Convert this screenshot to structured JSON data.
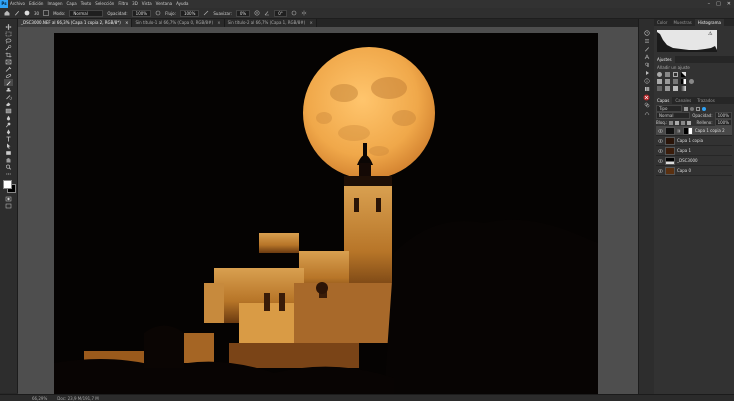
{
  "menubar": {
    "logo": "Ps",
    "items": [
      "Archivo",
      "Edición",
      "Imagen",
      "Capa",
      "Texto",
      "Selección",
      "Filtro",
      "3D",
      "Vista",
      "Ventana",
      "Ayuda"
    ]
  },
  "window_controls": {
    "minimize": "–",
    "maximize": "□",
    "close": "✕"
  },
  "options": {
    "brush_size": "30",
    "mode_label": "Modo:",
    "mode_value": "Normal",
    "opacity_label": "Opacidad:",
    "opacity_value": "100%",
    "flow_label": "Flujo:",
    "flow_value": "100%",
    "smoothing_label": "Suavizar:",
    "smoothing_value": "0%",
    "angle_value": "0°"
  },
  "doc_tabs": [
    {
      "label": "_DSC3000.NEF al 66,3% (Capa 1 copia 2, RGB/8*)",
      "close": "×"
    },
    {
      "label": "Sin título-1 al 66,7% (Capa 0, RGB/8#)",
      "close": "×"
    },
    {
      "label": "Sin título-2 al 66,7% (Capa 1, RGB/8#)",
      "close": "×"
    }
  ],
  "status": {
    "zoom": "66,29%",
    "doc": "Doc: 23,9 M/191,7 M"
  },
  "panels": {
    "top_tabs": [
      "Color",
      "Muestras",
      "Histograma"
    ],
    "adjust_tabs": [
      "Ajustes"
    ],
    "adjust_hint": "Añadir un ajuste",
    "layers_tabs": [
      "Capas",
      "Canales",
      "Trazados"
    ],
    "filter_label": "Tipo",
    "blend_mode": "Normal",
    "opacity_label": "Opacidad:",
    "opacity_value": "100%",
    "lock_label": "Bloq.:",
    "fill_label": "Relleno:",
    "fill_value": "100%",
    "layers": [
      {
        "name": "Capa 1 copia 2",
        "selected": true,
        "mask": true
      },
      {
        "name": "Capa 1 copia",
        "selected": false,
        "mask": false
      },
      {
        "name": "Capa 1",
        "selected": false,
        "mask": false
      },
      {
        "name": "_DSC3000",
        "selected": false,
        "mask": false
      },
      {
        "name": "Capa 0",
        "selected": false,
        "mask": false
      }
    ]
  },
  "colors": {
    "accent": "#2fa3f7",
    "moon": "#f0a84a",
    "building": "#c98a3a",
    "sky": "#050302"
  }
}
